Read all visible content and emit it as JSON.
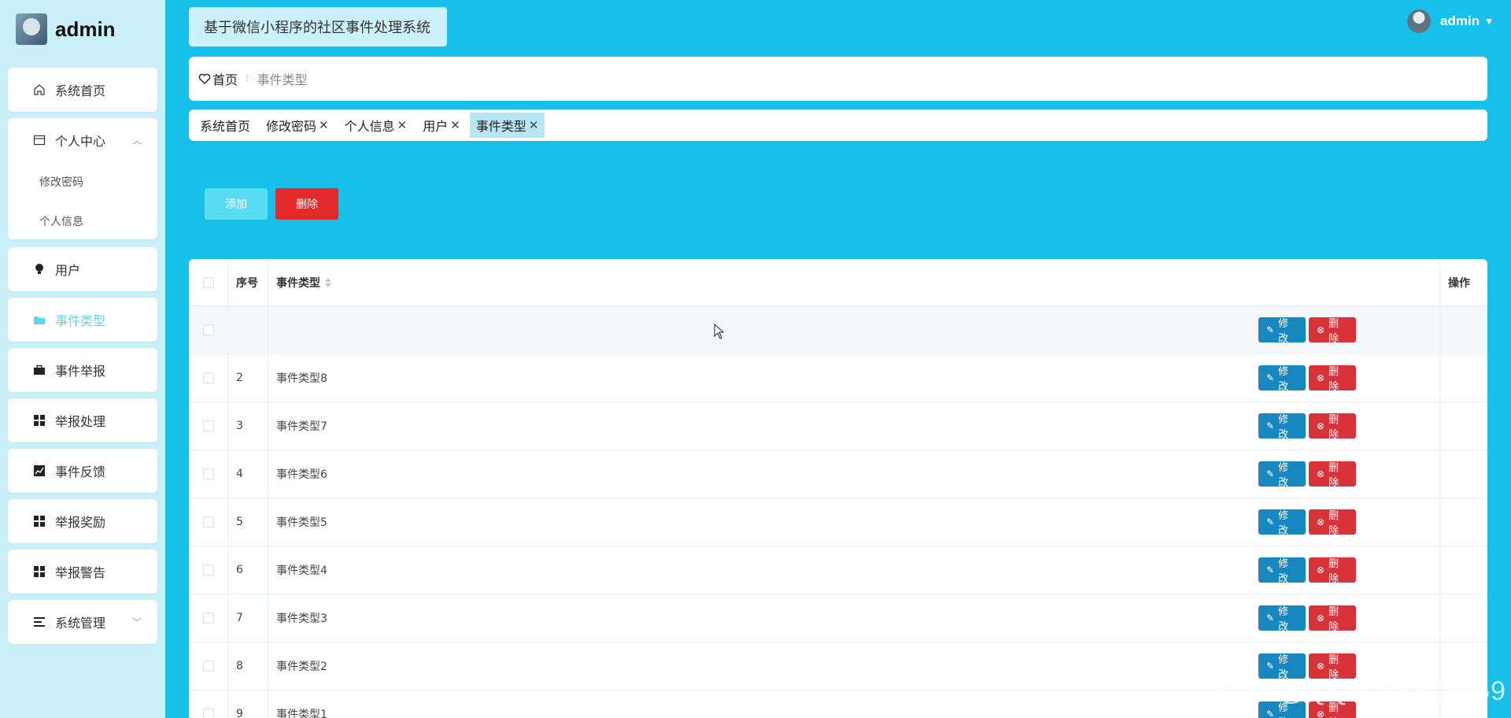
{
  "brand": {
    "name": "admin"
  },
  "header": {
    "title": "基于微信小程序的社区事件处理系统",
    "user": "admin"
  },
  "sidebar": {
    "items": [
      {
        "label": "系统首页",
        "icon": "home-icon"
      },
      {
        "label": "个人中心",
        "icon": "card-icon",
        "sub": [
          "修改密码",
          "个人信息"
        ]
      },
      {
        "label": "用户",
        "icon": "bulb-icon"
      },
      {
        "label": "事件类型",
        "icon": "folder-icon",
        "active": true
      },
      {
        "label": "事件举报",
        "icon": "briefcase-icon"
      },
      {
        "label": "举报处理",
        "icon": "grid-icon"
      },
      {
        "label": "事件反馈",
        "icon": "chart-icon"
      },
      {
        "label": "举报奖励",
        "icon": "grid-icon"
      },
      {
        "label": "举报警告",
        "icon": "grid-icon"
      },
      {
        "label": "系统管理",
        "icon": "list-icon"
      }
    ]
  },
  "breadcrumb": {
    "home": "首页",
    "separator": "⁝",
    "current": "事件类型"
  },
  "tags": [
    {
      "label": "系统首页",
      "closable": false
    },
    {
      "label": "修改密码",
      "closable": true
    },
    {
      "label": "个人信息",
      "closable": true
    },
    {
      "label": "用户",
      "closable": true
    },
    {
      "label": "事件类型",
      "closable": true,
      "active": true
    }
  ],
  "actions": {
    "add": "添加",
    "delete": "删除"
  },
  "table": {
    "headers": {
      "index": "序号",
      "name": "事件类型",
      "ops": "操作"
    },
    "rows": [
      {
        "index": "",
        "name": ""
      },
      {
        "index": "2",
        "name": "事件类型8"
      },
      {
        "index": "3",
        "name": "事件类型7"
      },
      {
        "index": "4",
        "name": "事件类型6"
      },
      {
        "index": "5",
        "name": "事件类型5"
      },
      {
        "index": "6",
        "name": "事件类型4"
      },
      {
        "index": "7",
        "name": "事件类型3"
      },
      {
        "index": "8",
        "name": "事件类型2"
      },
      {
        "index": "9",
        "name": "事件类型1"
      }
    ],
    "edit_label": "修改",
    "delete_label": "删除"
  },
  "watermark": "CSDN @QQ2079523559",
  "colors": {
    "background": "#17c0e9",
    "sidebar": "#c9eff9",
    "active": "#5ad7f2",
    "edit": "#1788bf",
    "danger": "#d9333a"
  }
}
